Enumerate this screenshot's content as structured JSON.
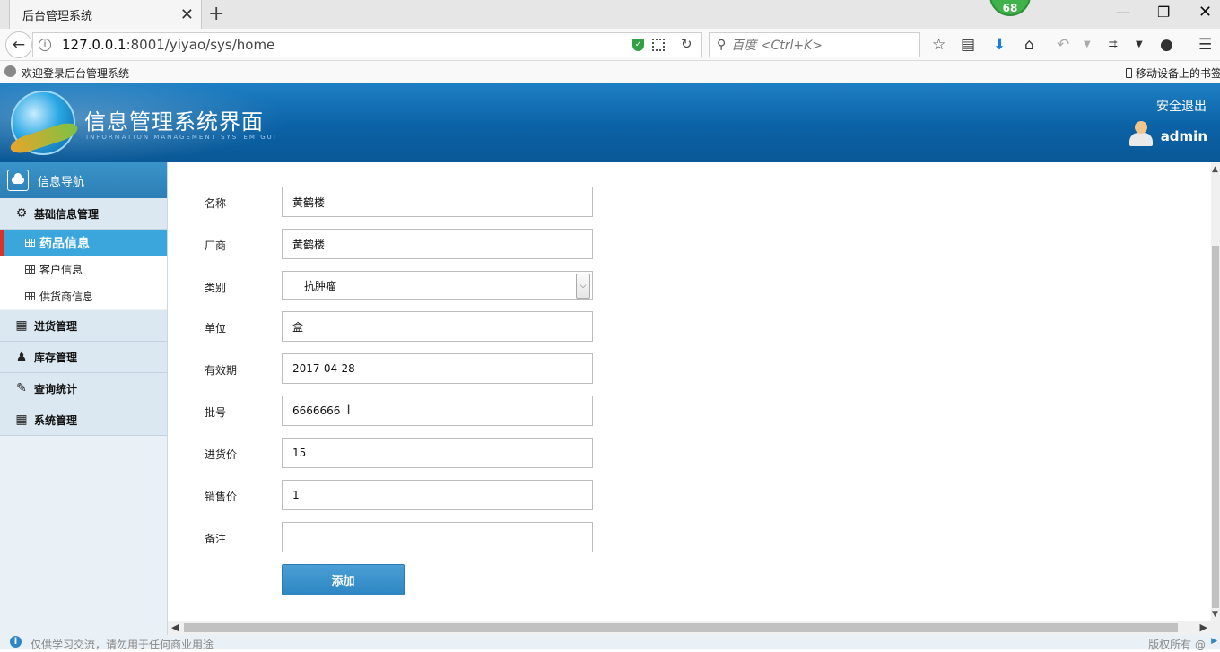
{
  "browser": {
    "tab_title": "后台管理系统",
    "tab_close": "✕",
    "new_tab": "+",
    "notification_count": "68",
    "url_host": "127.0.0.1",
    "url_rest": ":8001/yiyao/sys/home",
    "search_placeholder": "百度 <Ctrl+K>",
    "bookmark_label": "欢迎登录后台管理系统",
    "mobile_bookmarks": "移动设备上的书签"
  },
  "header": {
    "title": "信息管理系统界面",
    "subtitle": "INFORMATION MANAGEMENT SYSTEM GUI",
    "logout": "安全退出",
    "username": "admin"
  },
  "sidebar": {
    "head": "信息导航",
    "groups": [
      {
        "label": "基础信息管理",
        "icon": "gears-icon"
      },
      {
        "label": "进货管理",
        "icon": "calendar-icon"
      },
      {
        "label": "库存管理",
        "icon": "stock-icon"
      },
      {
        "label": "查询统计",
        "icon": "edit-icon"
      },
      {
        "label": "系统管理",
        "icon": "calendar-icon"
      }
    ],
    "sub_items": [
      "药品信息",
      "客户信息",
      "供货商信息"
    ],
    "active_item": "药品信息"
  },
  "form": {
    "fields": [
      {
        "label": "名称",
        "value": "黄鹤楼"
      },
      {
        "label": "厂商",
        "value": "黄鹤楼"
      },
      {
        "label": "类别",
        "value": "抗肿瘤"
      },
      {
        "label": "单位",
        "value": "盒"
      },
      {
        "label": "有效期",
        "value": "2017-04-28"
      },
      {
        "label": "批号",
        "value": "6666666"
      },
      {
        "label": "进货价",
        "value": "15"
      },
      {
        "label": "销售价",
        "value": "1"
      },
      {
        "label": "备注",
        "value": ""
      }
    ],
    "submit_label": "添加"
  },
  "footer": {
    "left": "仅供学习交流，请勿用于任何商业用途",
    "right": "版权所有 @"
  },
  "colors": {
    "header_blue": "#0b62a6",
    "active_item": "#3aa6dc",
    "button_blue": "#2e86c3",
    "active_marker": "#d9322b"
  }
}
